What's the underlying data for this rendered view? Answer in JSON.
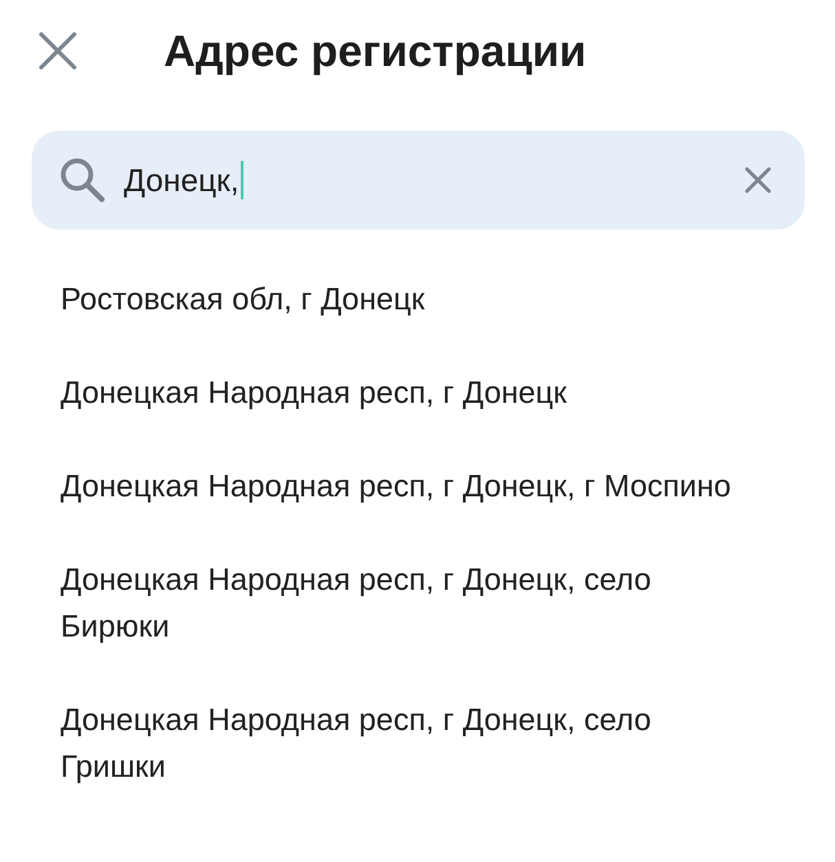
{
  "header": {
    "title": "Адрес регистрации"
  },
  "search": {
    "value": "Донецк,"
  },
  "results": [
    {
      "text": "Ростовская обл, г Донецк"
    },
    {
      "text": "Донецкая Народная респ, г Донецк"
    },
    {
      "text": "Донецкая Народная респ, г Донецк, г Моспино"
    },
    {
      "text": "Донецкая Народная респ, г Донецк, село Бирюки"
    },
    {
      "text": "Донецкая Народная респ, г Донецк, село Гришки"
    }
  ]
}
